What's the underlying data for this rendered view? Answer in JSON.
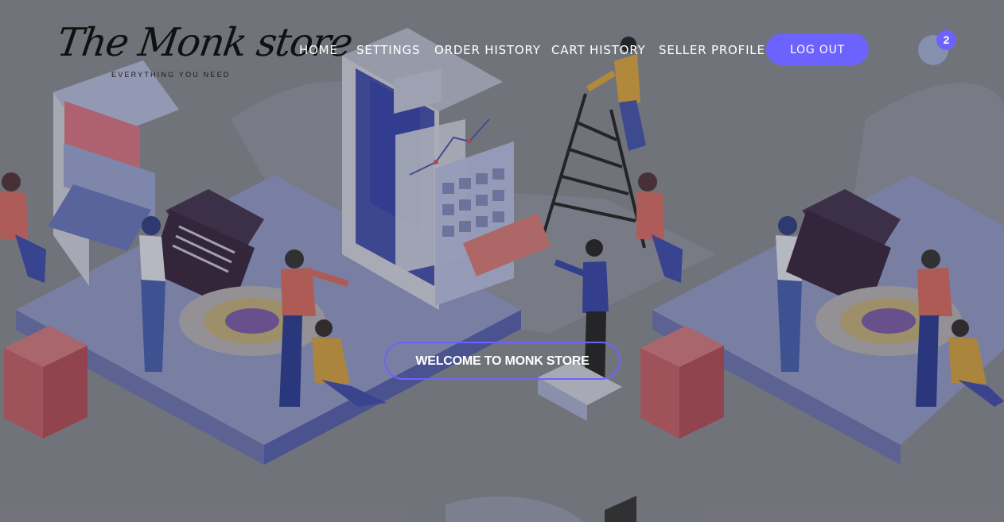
{
  "site": {
    "logo_title": "The Monk store",
    "logo_tagline": "EVERYTHING YOU NEED"
  },
  "nav": {
    "items": [
      {
        "label": "HOME"
      },
      {
        "label": "SETTINGS"
      },
      {
        "label": "ORDER HISTORY"
      },
      {
        "label": "CART HISTORY"
      },
      {
        "label": "SELLER PROFILE"
      }
    ],
    "logout_label": "LOG OUT"
  },
  "cart": {
    "count": "2"
  },
  "hero": {
    "button_label": "WELCOME TO MONK STORE"
  },
  "colors": {
    "accent": "#6c63ff",
    "overlay": "#777a80",
    "text_light": "#ffffff",
    "logo_text": "#111111"
  },
  "icons": {
    "cart": "cart-icon"
  }
}
